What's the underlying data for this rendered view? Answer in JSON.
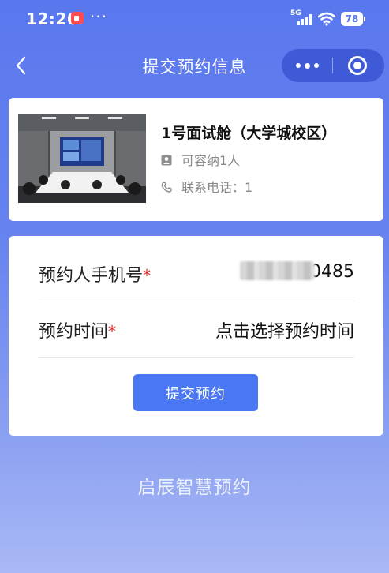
{
  "status_bar": {
    "time": "12:26",
    "dots": "···",
    "network": "5G",
    "battery": "78"
  },
  "nav": {
    "title": "提交预约信息"
  },
  "room": {
    "name": "1号面试舱（大学城校区）",
    "capacity": "可容纳1人",
    "phone": "联系电话：1"
  },
  "form": {
    "phone_label": "预约人手机号",
    "phone_value_visible": "0485",
    "time_label": "预约时间",
    "time_value": "点击选择预约时间",
    "required_mark": "*",
    "submit_label": "提交预约"
  },
  "footer": {
    "brand": "启辰智慧预约"
  },
  "colors": {
    "background_top": "#5a78ee",
    "background_bottom": "#a9b8f6",
    "capsule": "#3e5ad6",
    "primary_button": "#4a78f4",
    "required": "#e02020"
  },
  "icons": {
    "capacity": "person-badge-icon",
    "phone": "phone-icon"
  }
}
